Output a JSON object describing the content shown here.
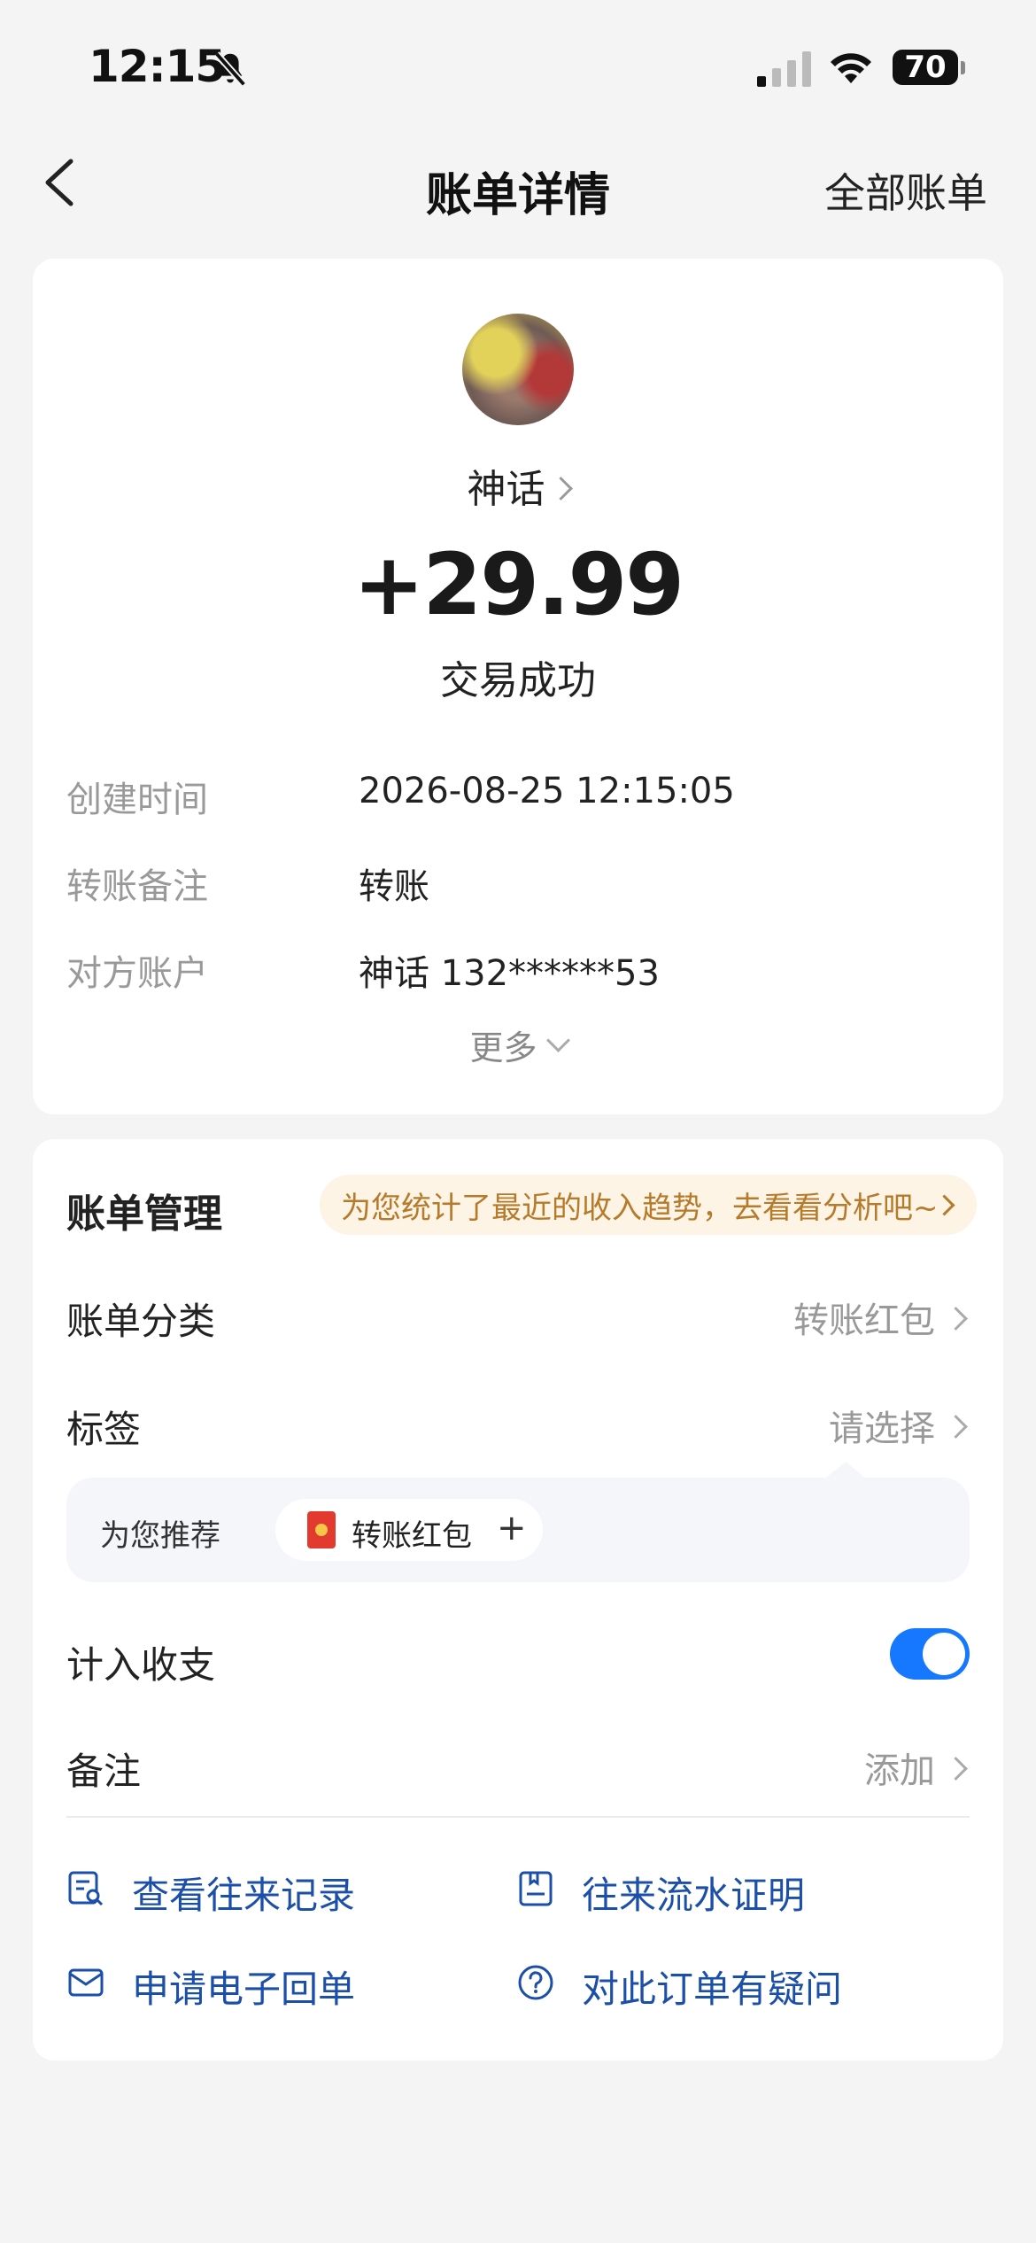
{
  "status_bar": {
    "time": "12:15",
    "battery": "70"
  },
  "nav": {
    "title": "账单详情",
    "right_link": "全部账单"
  },
  "transaction": {
    "payee": "神话",
    "amount": "+29.99",
    "status": "交易成功",
    "details": [
      {
        "label": "创建时间",
        "value": "2026-08-25 12:15:05"
      },
      {
        "label": "转账备注",
        "value": "转账"
      },
      {
        "label": "对方账户",
        "value": "神话 132******53"
      }
    ],
    "more_label": "更多"
  },
  "management": {
    "title": "账单管理",
    "promo": "为您统计了最近的收入趋势，去看看分析吧~",
    "category": {
      "label": "账单分类",
      "value": "转账红包"
    },
    "tag": {
      "label": "标签",
      "value": "请选择"
    },
    "recommend": {
      "label": "为您推荐",
      "chip": "转账红包"
    },
    "count_in": {
      "label": "计入收支",
      "enabled": true
    },
    "note": {
      "label": "备注",
      "value": "添加"
    },
    "actions": [
      {
        "label": "查看往来记录",
        "icon": "record-search-icon"
      },
      {
        "label": "往来流水证明",
        "icon": "certificate-icon"
      },
      {
        "label": "申请电子回单",
        "icon": "mail-icon"
      },
      {
        "label": "对此订单有疑问",
        "icon": "question-icon"
      }
    ]
  },
  "colors": {
    "accent": "#1677ff",
    "action_text": "#1c4fa8",
    "promo_text": "#b57a2a",
    "promo_bg": "#fdf4e6"
  }
}
